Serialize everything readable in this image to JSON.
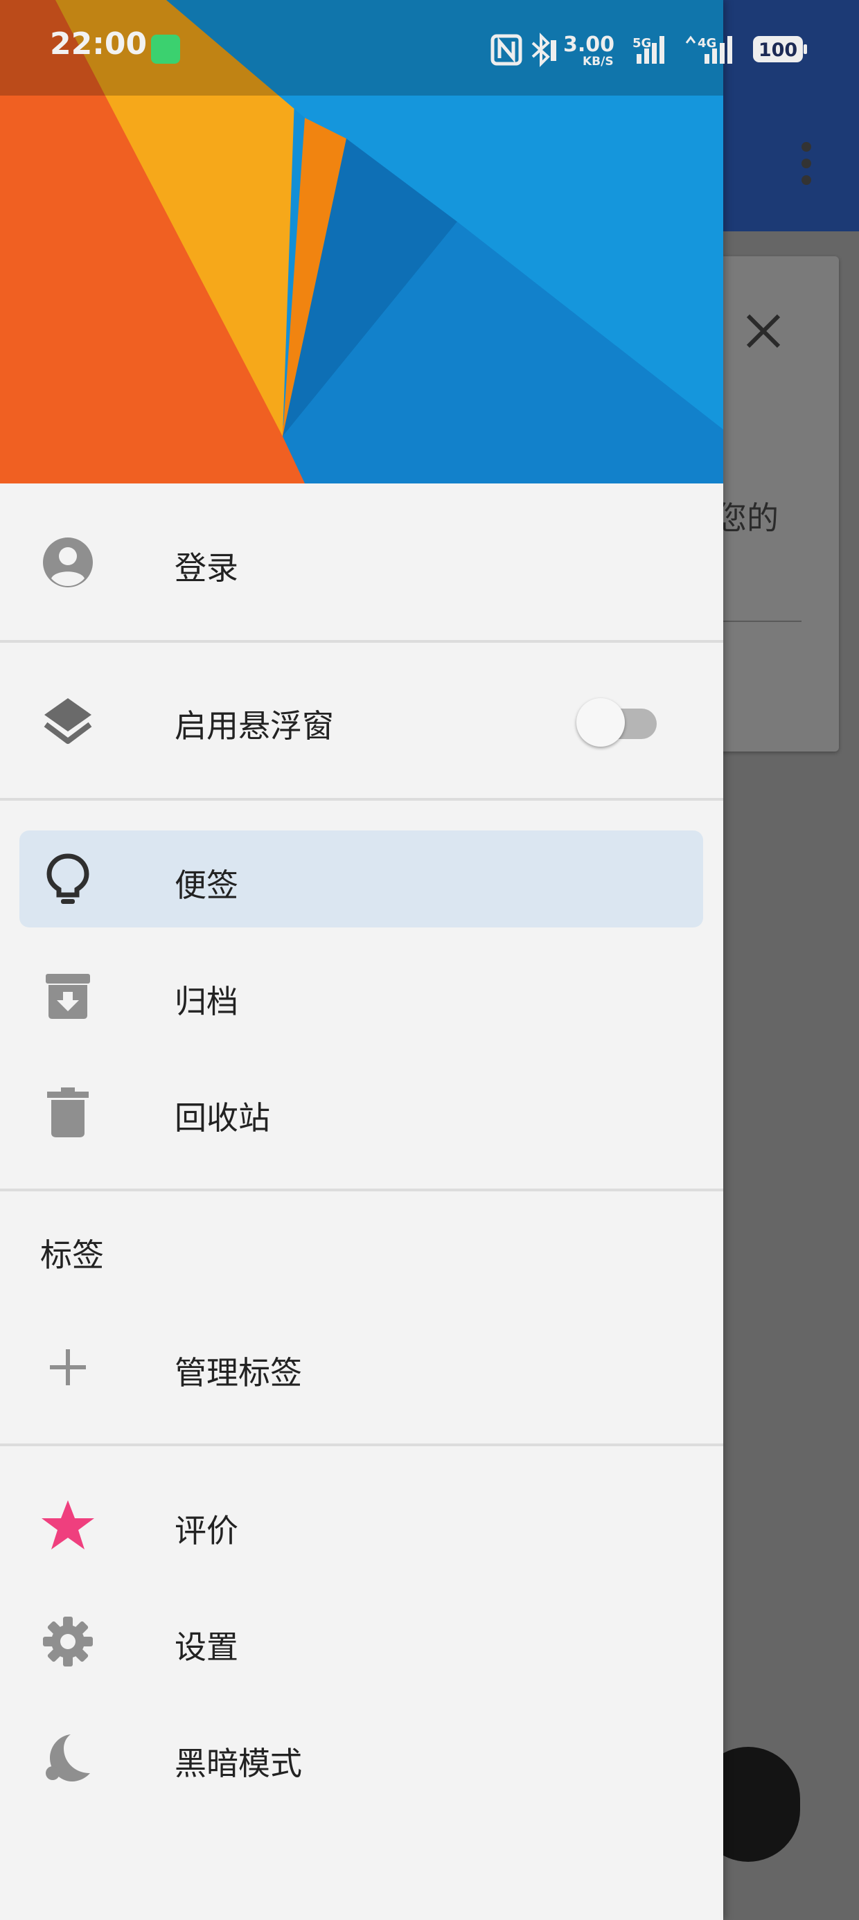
{
  "status_bar": {
    "time": "22:00",
    "net_speed_value": "3.00",
    "net_speed_unit": "KB/S",
    "sim1_type": "5G",
    "sim2_type": "4G",
    "battery": "100"
  },
  "background_app": {
    "card_text_fragment": "您的"
  },
  "drawer": {
    "account": {
      "label": "登录",
      "icon": "account-circle-icon"
    },
    "floating_window": {
      "label": "启用悬浮窗",
      "icon": "layers-icon",
      "enabled": false
    },
    "items": [
      {
        "label": "便签",
        "icon": "lightbulb-icon",
        "selected": true
      },
      {
        "label": "归档",
        "icon": "archive-icon",
        "selected": false
      },
      {
        "label": "回收站",
        "icon": "trash-icon",
        "selected": false
      }
    ],
    "labels_section": {
      "title": "标签",
      "manage_label": "管理标签",
      "manage_icon": "plus-icon"
    },
    "footer_items": [
      {
        "label": "评价",
        "icon": "star-icon",
        "color": "#ef3f7e"
      },
      {
        "label": "设置",
        "icon": "gear-icon"
      },
      {
        "label": "黑暗模式",
        "icon": "moon-icon"
      }
    ]
  },
  "colors": {
    "selected_bg": "#dbe6f1",
    "icon_gray": "#8f8f8f",
    "star_pink": "#ef3f7e",
    "toolbar": "#1c3a75"
  }
}
